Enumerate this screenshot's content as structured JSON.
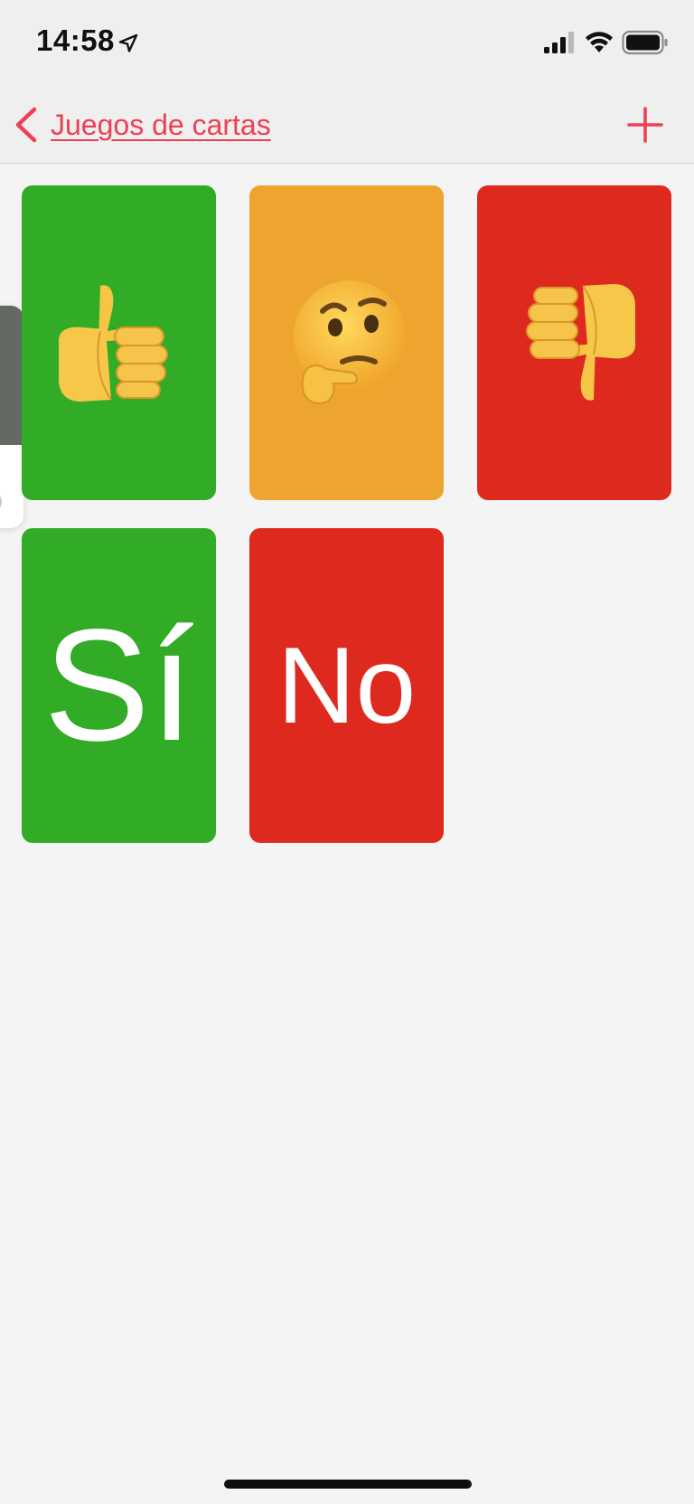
{
  "status_bar": {
    "time": "14:58",
    "icons": [
      "location-icon",
      "signal-icon",
      "wifi-icon",
      "battery-icon"
    ]
  },
  "nav": {
    "back_label": "Juegos de cartas",
    "back_icon": "chevron-left-icon",
    "add_icon": "plus-icon",
    "accent_color": "#ef3f53"
  },
  "cards": [
    {
      "kind": "emoji",
      "icon": "thumbs-up-icon",
      "color": "#32ab26"
    },
    {
      "kind": "emoji",
      "icon": "thinking-face-icon",
      "color": "#eea52f"
    },
    {
      "kind": "emoji",
      "icon": "thumbs-down-icon",
      "color": "#de291e"
    },
    {
      "kind": "text",
      "label": "Sí",
      "color": "#32ab26"
    },
    {
      "kind": "text",
      "label": "No",
      "color": "#de291e"
    }
  ]
}
